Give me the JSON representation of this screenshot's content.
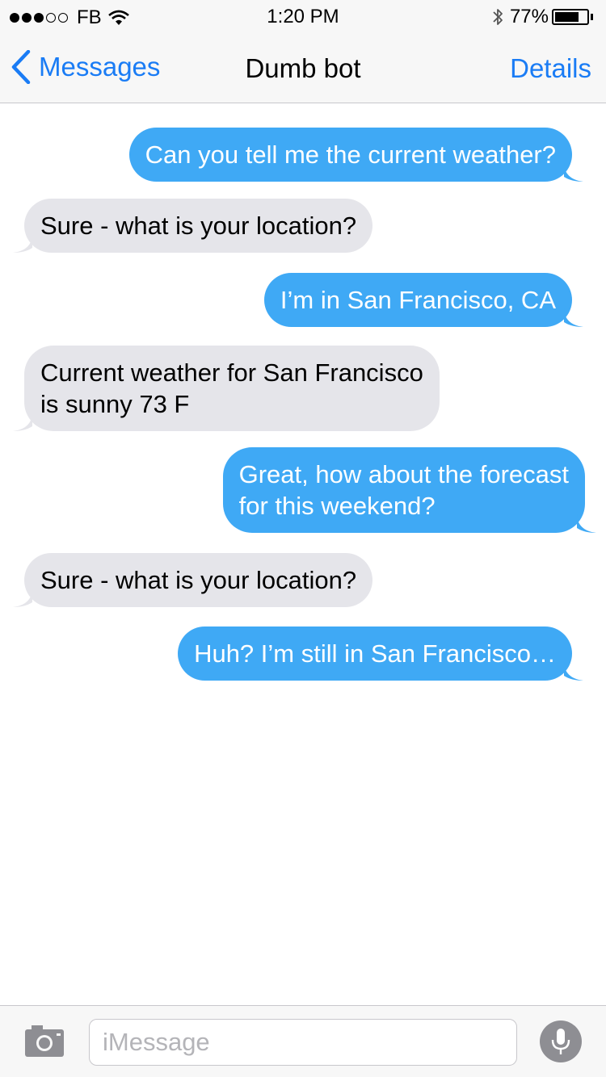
{
  "status_bar": {
    "carrier": "FB",
    "signal_bars_filled": 3,
    "signal_bars_total": 5,
    "time": "1:20 PM",
    "battery_percent": "77%",
    "battery_level": 0.77,
    "icons": [
      "wifi-icon",
      "bluetooth-icon",
      "battery-icon"
    ]
  },
  "nav": {
    "back_label": "Messages",
    "title": "Dumb bot",
    "details_label": "Details"
  },
  "messages": [
    {
      "side": "out",
      "lines": [
        "Can you tell me the current weather?"
      ]
    },
    {
      "side": "in",
      "lines": [
        "Sure - what is your location?"
      ]
    },
    {
      "side": "out",
      "lines": [
        "I’m in San Francisco, CA"
      ]
    },
    {
      "side": "in",
      "lines": [
        "Current weather for San Francisco",
        "is sunny 73 F"
      ]
    },
    {
      "side": "out",
      "lines": [
        "Great, how about the forecast",
        "for this weekend?"
      ]
    },
    {
      "side": "in",
      "lines": [
        "Sure - what is your location?"
      ]
    },
    {
      "side": "out",
      "lines": [
        "Huh? I’m still in San Francisco…"
      ]
    }
  ],
  "input": {
    "placeholder": "iMessage",
    "value": ""
  },
  "colors": {
    "accent": "#1a7cf5",
    "outgoing_bubble": "#3fa9f5",
    "incoming_bubble": "#e5e5ea",
    "bar_background": "#f7f7f7"
  }
}
